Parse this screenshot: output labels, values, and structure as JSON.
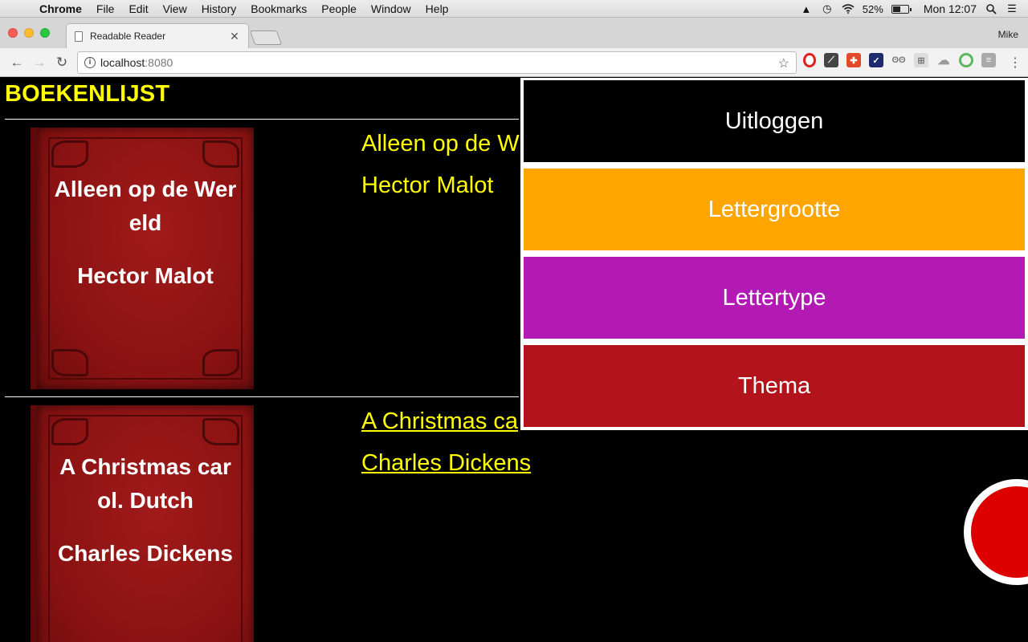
{
  "menubar": {
    "app": "Chrome",
    "items": [
      "File",
      "Edit",
      "View",
      "History",
      "Bookmarks",
      "People",
      "Window",
      "Help"
    ],
    "battery_percent": "52%",
    "battery_level": 0.52,
    "clock": "Mon 12:07"
  },
  "browser": {
    "tab_title": "Readable Reader",
    "profile_name": "Mike",
    "url_host": "localhost",
    "url_port": ":8080",
    "extension_icons": [
      "opera-icon",
      "feather-icon",
      "puzzle-icon",
      "bird-icon",
      "eyes-icon",
      "grid-icon",
      "cloud-icon",
      "circle-icon",
      "rss-icon"
    ]
  },
  "page": {
    "title": "BOEKENLIJST",
    "books": [
      {
        "title": "Alleen op de Wereld",
        "author": "Hector Malot",
        "cover_title": "Alleen op de Wereld",
        "cover_author": "Hector Malot",
        "visible_title": "Alleen op de W",
        "linked": false
      },
      {
        "title": "A Christmas carol. Dutch",
        "author": "Charles Dickens",
        "cover_title": "A Christmas carol. Dutch",
        "cover_author": "Charles Dickens",
        "visible_title": "A Christmas ca",
        "linked": true
      }
    ]
  },
  "overlay_menu": {
    "items": [
      {
        "label": "Uitloggen",
        "color": "#000000"
      },
      {
        "label": "Lettergrootte",
        "color": "#ffa500"
      },
      {
        "label": "Lettertype",
        "color": "#b31ab3"
      },
      {
        "label": "Thema",
        "color": "#b3141b"
      }
    ]
  },
  "colors": {
    "accent_text": "#ffff00",
    "page_bg": "#000000",
    "fab": "#dd0000"
  }
}
